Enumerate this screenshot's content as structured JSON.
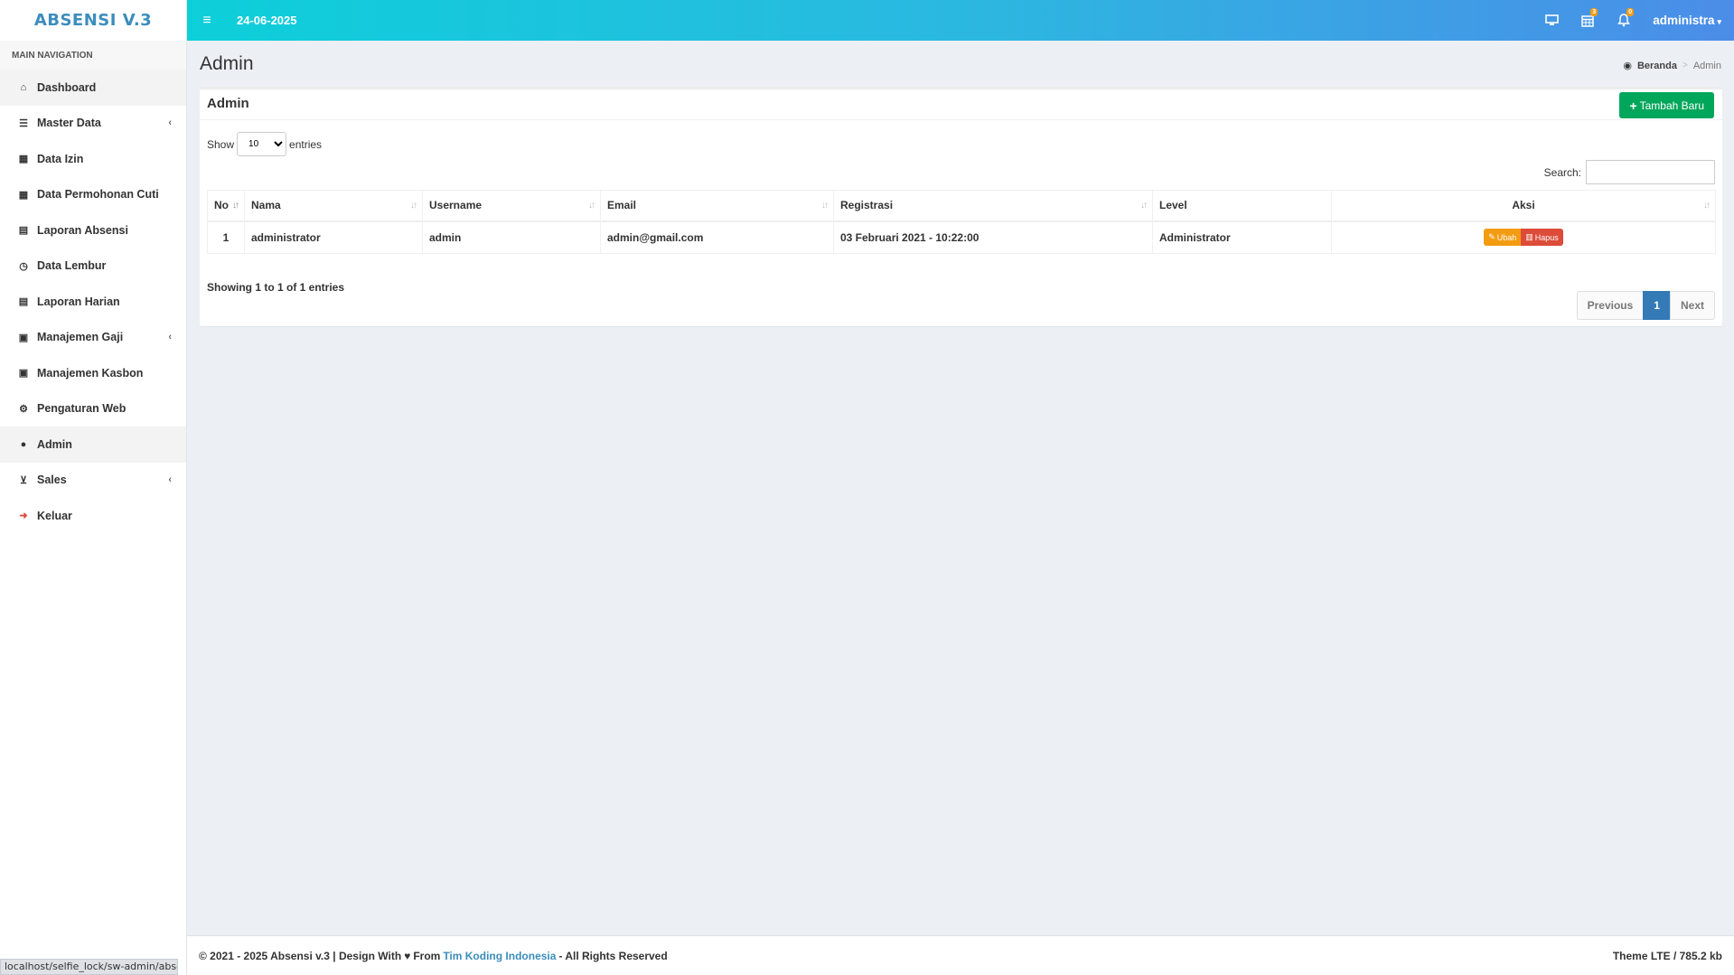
{
  "app": {
    "logo": "ABSENSI V.3"
  },
  "topbar": {
    "date": "24-06-2025",
    "calendar_badge": "3",
    "bell_badge": "0",
    "user": "administra"
  },
  "sidebar": {
    "header": "MAIN NAVIGATION",
    "items": [
      {
        "label": "Dashboard",
        "icon": "home-icon"
      },
      {
        "label": "Master Data",
        "icon": "database-icon"
      },
      {
        "label": "Data Izin",
        "icon": "calendar-icon"
      },
      {
        "label": "Data Permohonan Cuti",
        "icon": "calendar-icon"
      },
      {
        "label": "Laporan Absensi",
        "icon": "list-alt-icon"
      },
      {
        "label": "Data Lembur",
        "icon": "clock-icon"
      },
      {
        "label": "Laporan Harian",
        "icon": "list-alt-icon"
      },
      {
        "label": "Manajemen Gaji",
        "icon": "money-icon"
      },
      {
        "label": "Manajemen Kasbon",
        "icon": "money-icon"
      },
      {
        "label": "Pengaturan Web",
        "icon": "gears-icon"
      },
      {
        "label": "Admin",
        "icon": "user-icon"
      },
      {
        "label": "Sales",
        "icon": "cart-icon"
      },
      {
        "label": "Keluar",
        "icon": "sign-out-icon"
      }
    ]
  },
  "page": {
    "title": "Admin",
    "breadcrumb_home": "Beranda",
    "breadcrumb_current": "Admin"
  },
  "box": {
    "title": "Admin",
    "add_button": "Tambah Baru",
    "show_label": "Show",
    "entries_label": "entries",
    "page_length": "10",
    "search_label": "Search:",
    "search_value": "",
    "info": "Showing 1 to 1 of 1 entries"
  },
  "table": {
    "headers": [
      "No",
      "Nama",
      "Username",
      "Email",
      "Registrasi",
      "Level",
      "Aksi"
    ],
    "rows": [
      {
        "no": "1",
        "nama": "administrator",
        "username": "admin",
        "email": "admin@gmail.com",
        "registrasi": "03 Februari 2021 - 10:22:00",
        "level": "Administrator",
        "edit": "Ubah",
        "delete": "Hapus"
      }
    ]
  },
  "pagination": {
    "prev": "Previous",
    "current": "1",
    "next": "Next"
  },
  "footer": {
    "left_prefix": "© 2021 - 2025 Absensi v.3 | Design With",
    "from": "From",
    "link": "Tim Koding Indonesia",
    "left_suffix": "- All Rights Reserved",
    "right": "Theme LTE / 785.2 kb"
  },
  "status_url": "localhost/selfie_lock/sw-admin/abse"
}
